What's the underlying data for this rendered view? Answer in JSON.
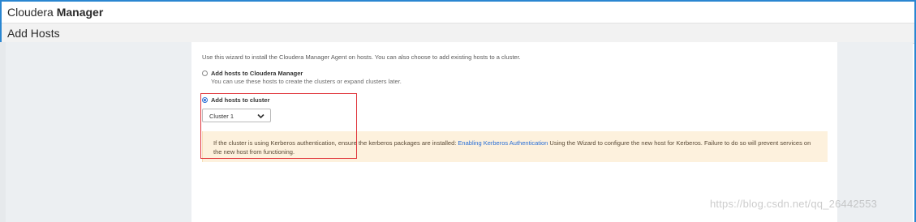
{
  "brand": {
    "light": "Cloudera ",
    "bold": "Manager"
  },
  "page": {
    "title": "Add Hosts"
  },
  "wizard": {
    "intro": "Use this wizard to install the Cloudera Manager Agent on hosts. You can also choose to add existing hosts to a cluster.",
    "options": [
      {
        "label": "Add hosts to Cloudera Manager",
        "description": "You can use these hosts to create the clusters or expand clusters later.",
        "selected": false
      },
      {
        "label": "Add hosts to cluster",
        "selected": true
      }
    ],
    "cluster_select": {
      "value": "Cluster 1",
      "icon": "chevron-down-icon"
    },
    "warning": {
      "text_before": "If the cluster is using Kerberos authentication, ensure the kerberos packages are installed: ",
      "link": "Enabling Kerberos Authentication",
      "text_after": " Using the Wizard to configure the new host for Kerberos. Failure to do so will prevent services on the new host from functioning."
    }
  },
  "watermark": "https://blog.csdn.net/qq_26442553",
  "colors": {
    "accent": "#2a6fd6",
    "frame": "#2a86d1",
    "warning_bg": "#fdf1dd",
    "highlight": "#e0353b"
  }
}
